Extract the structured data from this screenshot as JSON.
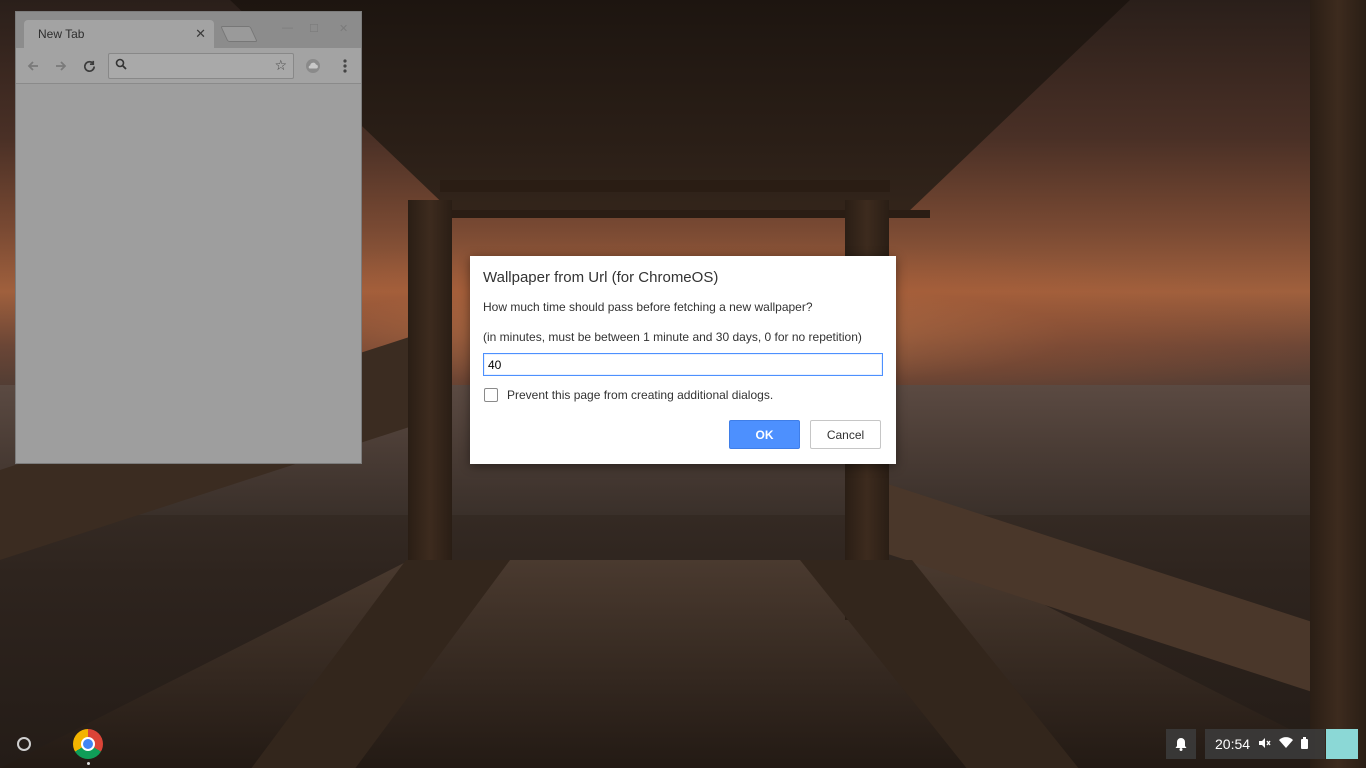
{
  "browser": {
    "tab_title": "New Tab",
    "tab_close": "✕",
    "omnibox_value": ""
  },
  "dialog": {
    "title": "Wallpaper from Url (for ChromeOS)",
    "message": "How much time should pass before fetching a new wallpaper?",
    "hint": "(in minutes, must be between 1 minute and 30 days, 0 for no repetition)",
    "input_value": "40",
    "checkbox_label": "Prevent this page from creating additional dialogs.",
    "checkbox_checked": false,
    "ok_label": "OK",
    "cancel_label": "Cancel",
    "accent_color": "#4d90fe"
  },
  "shelf": {
    "clock": "20:54",
    "ime_color": "#8bd8d6"
  },
  "icons": {
    "back": "arrow-left-icon",
    "forward": "arrow-right-icon",
    "reload": "reload-icon",
    "search": "search-icon",
    "bookmark": "star-icon",
    "extension": "cloud-icon",
    "menu": "kebab-menu-icon",
    "launcher": "launcher-icon",
    "chrome": "chrome-icon",
    "notifications": "bell-icon",
    "mute": "volume-muted-icon",
    "wifi": "wifi-icon",
    "battery": "battery-icon"
  }
}
